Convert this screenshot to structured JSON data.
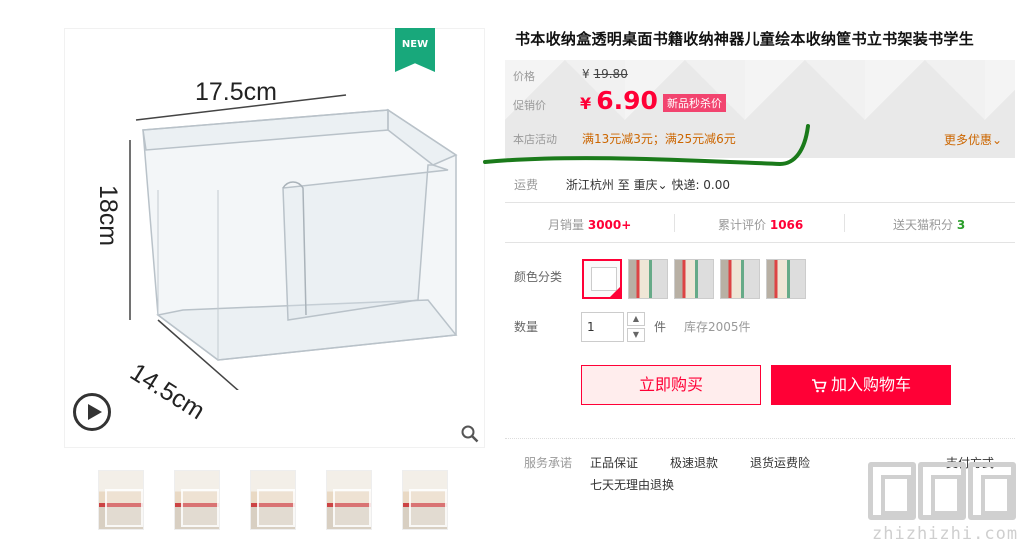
{
  "gallery": {
    "badge": "NEW",
    "dimensions": {
      "width": "17.5cm",
      "height": "18cm",
      "depth": "14.5cm"
    },
    "thumbnail_count": 5
  },
  "product": {
    "title": "书本收纳盒透明桌面书籍收纳神器儿童绘本收纳筐书立书架装书学生"
  },
  "price": {
    "original_label": "价格",
    "original_currency": "¥",
    "original_value": "19.80",
    "promo_label": "促销价",
    "promo_currency": "¥",
    "promo_value": "6.90",
    "promo_tag": "新品秒杀价",
    "activity_label": "本店活动",
    "activity_text": "满13元减3元；满25元减6元",
    "more_deals": "更多优惠"
  },
  "shipping": {
    "label": "运费",
    "from": "浙江杭州",
    "to_prefix": "至",
    "to": "重庆",
    "express": "快递: 0.00"
  },
  "stats": {
    "monthly_sales_label": "月销量",
    "monthly_sales_value": "3000+",
    "reviews_label": "累计评价",
    "reviews_value": "1066",
    "points_label": "送天猫积分",
    "points_value": "3"
  },
  "options": {
    "color_label": "颜色分类",
    "swatch_count": 5,
    "quantity_label": "数量",
    "quantity_value": "1",
    "quantity_unit": "件",
    "stock": "库存2005件"
  },
  "actions": {
    "buy_now": "立即购买",
    "add_to_cart": "加入购物车"
  },
  "service": {
    "label": "服务承诺",
    "items": [
      "正品保证",
      "极速退款",
      "退货运费险",
      "七天无理由退换"
    ],
    "payment": "支付方式"
  },
  "watermark": "zhizhizhi.com",
  "colors": {
    "accent": "#ff0036",
    "activity": "#cc6600",
    "badge": "#18a87b",
    "annotation": "#1a7a1a"
  }
}
